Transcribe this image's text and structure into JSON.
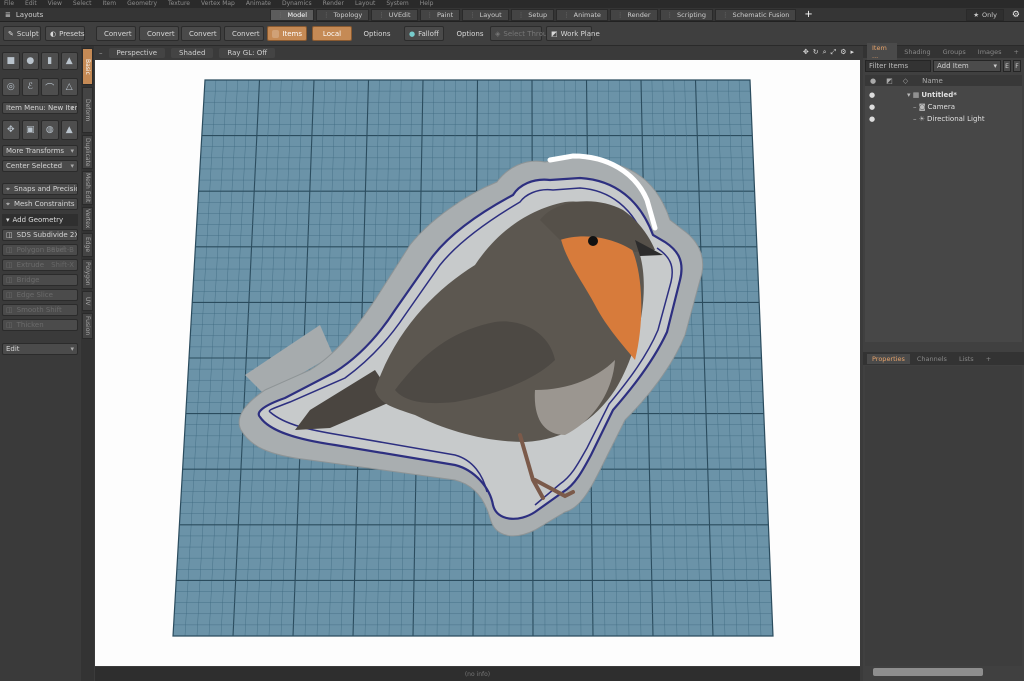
{
  "menu": [
    "File",
    "Edit",
    "View",
    "Select",
    "Item",
    "Geometry",
    "Texture",
    "Vertex Map",
    "Animate",
    "Dynamics",
    "Render",
    "Layout",
    "System",
    "Help"
  ],
  "title": {
    "layouts_label": "Layouts",
    "tabs": [
      "Model",
      "Topology",
      "UVEdit",
      "Paint",
      "Layout",
      "Setup",
      "Animate",
      "Render",
      "Scripting",
      "Schematic Fusion"
    ],
    "active_tab": "Model",
    "only_label": "Only"
  },
  "toolbar": {
    "sculpt": "Sculpt",
    "presets": "Presets",
    "convert_1": "Convert",
    "convert_2": "Convert",
    "convert_3": "Convert",
    "convert_4": "Convert",
    "items": "Items",
    "local": "Local",
    "options_1": "Options",
    "falloff": "Falloff",
    "options_2": "Options",
    "select_through": "Select Through",
    "work_plane": "Work Plane"
  },
  "left": {
    "item_menu": "Item Menu: New Item",
    "more_transforms": "More Transforms",
    "center_selected": "Center Selected",
    "snaps": "Snaps and Precision",
    "mesh_constraints": "Mesh Constraints",
    "add_geometry": "Add Geometry",
    "sds_subdivide": "SDS Subdivide 2X",
    "polygon_bevel": "Polygon Bevel",
    "polygon_bevel_key": "Shift-B",
    "extrude": "Extrude",
    "extrude_key": "Shift-X",
    "bridge": "Bridge",
    "edge_slice": "Edge Slice",
    "smooth_shift": "Smooth Shift",
    "thicken": "Thicken",
    "edit": "Edit"
  },
  "vtabs": [
    "Basic",
    "Deform",
    "Duplicate",
    "Mesh Edit",
    "Vertex",
    "Edge",
    "Polygon",
    "UV",
    "Fusion"
  ],
  "viewport": {
    "perspective": "Perspective",
    "shaded": "Shaded",
    "raygl": "Ray GL: Off",
    "status": "(no info)"
  },
  "right": {
    "tabs": [
      "Item ...",
      "Shading",
      "Groups",
      "Images"
    ],
    "filter_items": "Filter Items",
    "add_item": "Add Item",
    "name_header": "Name",
    "tree": [
      {
        "label": "Untitled*",
        "indent": 0
      },
      {
        "label": "Camera",
        "indent": 1
      },
      {
        "label": "Directional Light",
        "indent": 1
      }
    ],
    "prop_tabs": [
      "Properties",
      "Channels",
      "Lists"
    ]
  },
  "colors": {
    "accent": "#c58a55",
    "grid_bg": "#6b93a8",
    "grid_line": "#2b4c5e",
    "cutter_body": "#a6abad",
    "cutter_edge": "#2d2f80",
    "robin_orange": "#d77b3b",
    "robin_body": "#5c5750"
  }
}
